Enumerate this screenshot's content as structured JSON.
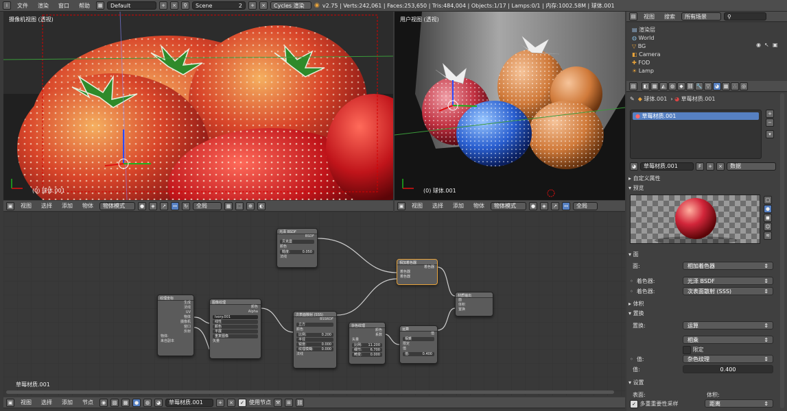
{
  "top_menu": {
    "items": [
      "文件",
      "渲染",
      "窗口",
      "帮助"
    ],
    "layout": "Default",
    "scene": "Scene",
    "scene_users": "2",
    "engine": "Cycles 渲染",
    "stats": "v2.75 | Verts:242,061 | Faces:253,650 | Tris:484,004 | Objects:1/17 | Lamps:0/1 | 内存:1002.58M | 球体.001"
  },
  "viewport_left": {
    "title": "摄像机视图 (透视)",
    "selection": "(0) 球体.001"
  },
  "viewport_right": {
    "title": "用户视图 (透视)",
    "selection": "(0) 球体.001"
  },
  "view3d_header_left": {
    "menus": [
      "视图",
      "选择",
      "添加",
      "物体"
    ],
    "mode": "物体模式",
    "global": "全局"
  },
  "view3d_header_right": {
    "menus": [
      "视图",
      "选择",
      "添加",
      "物体"
    ],
    "mode": "物体模式",
    "global": "全局"
  },
  "outliner": {
    "menus": [
      "视图",
      "搜索"
    ],
    "filter": "所有场景",
    "items": [
      {
        "label": "渲染层"
      },
      {
        "label": "World"
      },
      {
        "label": "BG"
      },
      {
        "label": "Camera"
      },
      {
        "label": "FOD"
      },
      {
        "label": "Lamp"
      }
    ]
  },
  "properties": {
    "breadcrumb": [
      "球体.001",
      "草莓材质.001"
    ],
    "material_slot": "草莓材质.001",
    "material_name": "草莓材质.001",
    "material_users": "F",
    "data_mode": "数据",
    "sections": {
      "custom": "自定义属性",
      "preview": "预览",
      "surface": "面",
      "volume": "体积",
      "displacement": "置换",
      "settings": "设置"
    },
    "surface": {
      "label": "面:",
      "value": "相加着色器",
      "shader1_label": "着色器:",
      "shader1": "光泽 BSDF",
      "shader2_label": "着色器:",
      "shader2": "次表面散射 (SSS)"
    },
    "displacement": {
      "label": "置换:",
      "value": "运算",
      "op": "相乘",
      "clamp": "限定",
      "value_label": "值:",
      "value_node": "杂色纹理",
      "value2_label": "值:",
      "value2": "0.400"
    },
    "settings": {
      "surface_label": "表面:",
      "volume_label": "体积:",
      "multiple_importance": "多重重要性采样",
      "distance": "距离"
    }
  },
  "node_editor": {
    "material_label": "草莓材质.001",
    "footer_menus": [
      "视图",
      "选择",
      "添加",
      "节点"
    ],
    "material_field": "草莓材质.001",
    "use_nodes": "使用节点"
  },
  "nodes": {
    "glossy": {
      "title": "光泽 BSDF",
      "out": "BSDF",
      "dist": "贝克曼",
      "color": "颜色",
      "rough_label": "糙度:",
      "rough": "0.050",
      "normal": "法线"
    },
    "addshader": {
      "title": "相加着色器",
      "out": "着色器",
      "in1": "着色器",
      "in2": "着色器"
    },
    "output": {
      "title": "材质输出",
      "in1": "面",
      "in2": "体积",
      "in3": "置换"
    },
    "texcoord": {
      "title": "纹理坐标",
      "outs": [
        "生成",
        "法线",
        "UV",
        "物体",
        "摄像机",
        "窗口",
        "反射"
      ],
      "object_label": "物体:",
      "from_dupli": "来自副本"
    },
    "imagetex": {
      "title": "图像纹理",
      "outs": [
        "颜色",
        "Alpha"
      ],
      "image": "Ivory.001",
      "interp": "线性",
      "color": "颜色",
      "proj": "平展",
      "ext": "重复图像",
      "vector": "矢量"
    },
    "sss": {
      "title": "次表面散射 (SSS)",
      "out": "BSSRDF",
      "falloff": "立方",
      "color": "颜色",
      "scale_label": "比例:",
      "scale": "0.200",
      "radius": "半径",
      "sharp_label": "锐度:",
      "sharp": "0.000",
      "tex_label": "纹理模糊:",
      "tex": "0.000",
      "normal": "法线"
    },
    "noise": {
      "title": "杂色纹理",
      "outs": [
        "颜色",
        "系数"
      ],
      "vector": "矢量",
      "scale_label": "比例:",
      "scale": "11.200",
      "detail_label": "细节:",
      "detail": "6.700",
      "dist_label": "畸变:",
      "dist": "0.000"
    },
    "math": {
      "title": "运算",
      "out": "值",
      "op": "相乘",
      "clamp": "限定",
      "value": "值",
      "value2_label": "值:",
      "value2": "0.400"
    }
  }
}
